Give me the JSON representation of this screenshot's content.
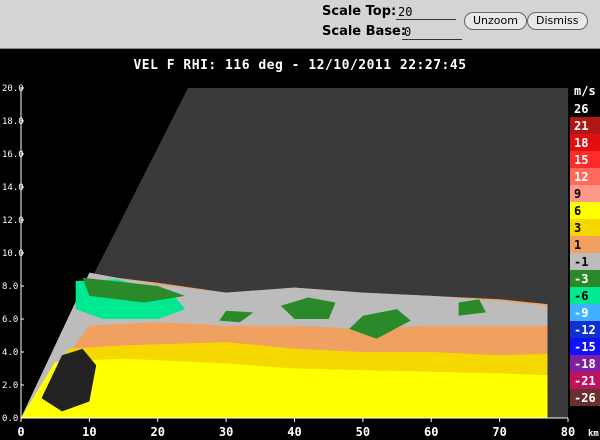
{
  "controls": {
    "scale_top_label": "Scale Top:",
    "scale_top_value": "20",
    "scale_base_label": "Scale Base:",
    "scale_base_value": "0",
    "unzoom_label": "Unzoom",
    "dismiss_label": "Dismiss"
  },
  "plot": {
    "title": "VEL F  RHI: 116 deg  -  12/10/2011 22:27:45",
    "colorbar_unit": "m/s",
    "x_unit_suffix": "km"
  },
  "chart_data": {
    "type": "heatmap",
    "title": "VEL F  RHI: 116 deg  -  12/10/2011 22:27:45",
    "xlabel": "km",
    "ylabel": "",
    "xlim": [
      0,
      80
    ],
    "ylim": [
      0,
      20
    ],
    "x_ticks": [
      "0",
      "10",
      "20",
      "30",
      "40",
      "50",
      "60",
      "70",
      "80"
    ],
    "y_ticks": [
      "0.0",
      "2.0",
      "4.0",
      "6.0",
      "8.0",
      "10.0",
      "12.0",
      "14.0",
      "16.0",
      "18.0",
      "20.0"
    ],
    "grid": false,
    "legend": "right colorbar",
    "colorbar": {
      "unit": "m/s",
      "levels": [
        {
          "label": "26",
          "color": "#000000"
        },
        {
          "label": "21",
          "color": "#b01818"
        },
        {
          "label": "18",
          "color": "#e01010"
        },
        {
          "label": "15",
          "color": "#ff2a2a"
        },
        {
          "label": "12",
          "color": "#ff6a5a"
        },
        {
          "label": "9",
          "color": "#ff9a8a"
        },
        {
          "label": "6",
          "color": "#ffff00"
        },
        {
          "label": "3",
          "color": "#f5d800"
        },
        {
          "label": "1",
          "color": "#f0a060"
        },
        {
          "label": "-1",
          "color": "#bcbcbc"
        },
        {
          "label": "-3",
          "color": "#2a8a2a"
        },
        {
          "label": "-6",
          "color": "#00e890"
        },
        {
          "label": "-9",
          "color": "#40b0ff"
        },
        {
          "label": "-12",
          "color": "#1030d0"
        },
        {
          "label": "-15",
          "color": "#1010ff"
        },
        {
          "label": "-18",
          "color": "#8020a0"
        },
        {
          "label": "-21",
          "color": "#c01060"
        },
        {
          "label": "-26",
          "color": "#6a3030"
        }
      ]
    }
  }
}
